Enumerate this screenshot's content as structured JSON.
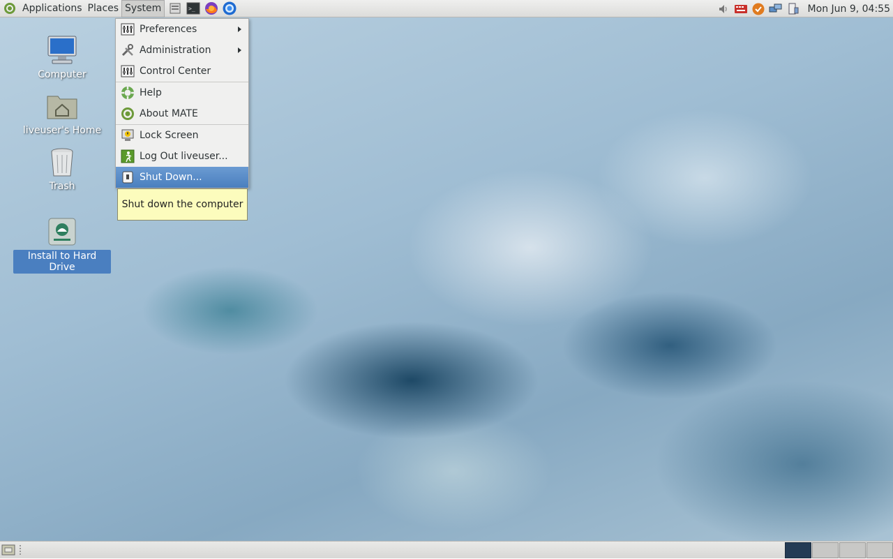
{
  "top_panel": {
    "menus": [
      "Applications",
      "Places",
      "System"
    ],
    "clock": "Mon Jun  9, 04:55"
  },
  "desktop": {
    "icons": [
      {
        "label": "Computer"
      },
      {
        "label": "liveuser's Home"
      },
      {
        "label": "Trash"
      },
      {
        "label": "Install to Hard Drive"
      }
    ]
  },
  "system_menu": {
    "items": [
      {
        "label": "Preferences"
      },
      {
        "label": "Administration"
      },
      {
        "label": "Control Center"
      },
      {
        "label": "Help"
      },
      {
        "label": "About MATE"
      },
      {
        "label": "Lock Screen"
      },
      {
        "label": "Log Out liveuser..."
      },
      {
        "label": "Shut Down..."
      }
    ],
    "highlighted": "Shut Down..."
  },
  "tooltip": {
    "text": "Shut down the computer"
  },
  "bottom_panel": {
    "workspaces": 4,
    "active_workspace": 1
  },
  "colors": {
    "highlight": "#4a7fbe",
    "tooltip_bg": "#fcfcbd",
    "panel_bg": "#dcdcda"
  }
}
